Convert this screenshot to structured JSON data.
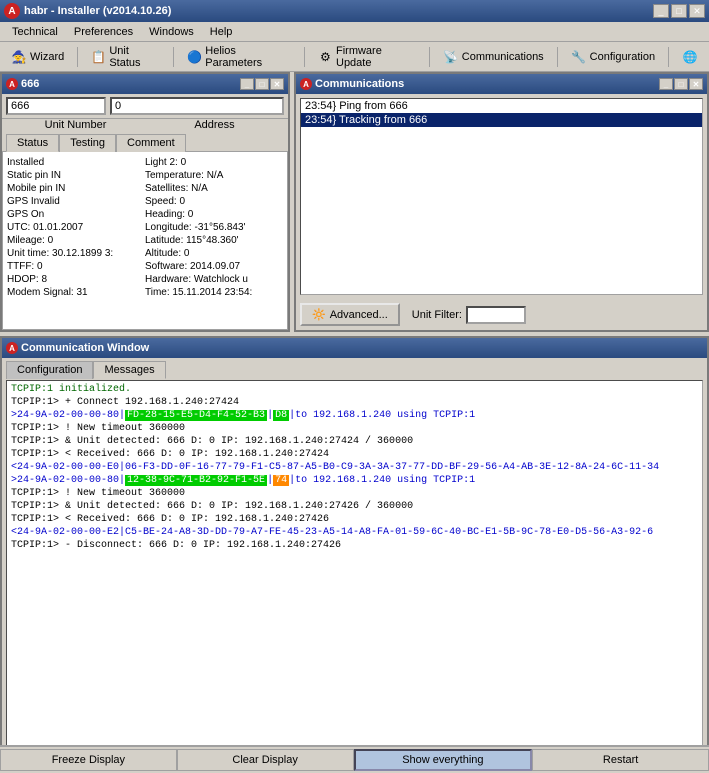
{
  "titlebar": {
    "icon": "A",
    "title": "habr - Installer (v2014.10.26)",
    "btns": [
      "_",
      "□",
      "✕"
    ]
  },
  "menubar": {
    "items": [
      "Technical",
      "Preferences",
      "Windows",
      "Help"
    ]
  },
  "toolbar": {
    "buttons": [
      {
        "icon": "🧙",
        "label": "Wizard"
      },
      {
        "icon": "📋",
        "label": "Unit Status"
      },
      {
        "icon": "🔵",
        "label": "Helios Parameters"
      },
      {
        "icon": "⚙",
        "label": "Firmware Update"
      },
      {
        "icon": "📡",
        "label": "Communications"
      },
      {
        "icon": "🔧",
        "label": "Configuration"
      },
      {
        "icon": "🌐",
        "label": ""
      }
    ]
  },
  "unit_window": {
    "title": "666",
    "number_value": "666",
    "address_value": "0",
    "col1_label": "Unit Number",
    "col2_label": "Address",
    "tabs": [
      "Status",
      "Testing",
      "Comment"
    ],
    "active_tab": "Status",
    "status": {
      "col1": [
        "Installed",
        "Static pin IN",
        "Mobile pin IN",
        "GPS Invalid",
        "GPS On",
        "UTC: 01.01.2007",
        "Mileage: 0",
        "Unit time: 30.12.1899 3:",
        "TTFF: 0",
        "HDOP: 8",
        "Modem Signal: 31"
      ],
      "col2": [
        "Light 2: 0",
        "Temperature: N/A",
        "Satellites: N/A",
        "Speed: 0",
        "Heading: 0",
        "Longitude: -31°56.843'",
        "Latitude: 115°48.360'",
        "Altitude: 0",
        "Software: 2014.09.07",
        "Hardware: Watchlock u",
        "Time: 15.11.2014 23:54:"
      ]
    }
  },
  "comm_window": {
    "title": "Communications",
    "items": [
      {
        "text": "23:54} Ping from 666",
        "selected": false
      },
      {
        "text": "23:54} Tracking from 666",
        "selected": true
      }
    ],
    "advanced_btn": "Advanced...",
    "unit_filter_label": "Unit Filter:"
  },
  "comm_bottom": {
    "title": "Communication Window",
    "tabs": [
      "Configuration",
      "Messages"
    ],
    "active_tab": "Messages",
    "log": [
      {
        "text": "TCPIP:1 initialized.",
        "style": "green"
      },
      {
        "text": "TCPIP:1> + Connect  192.168.1.240:27424",
        "style": "default"
      },
      {
        "text": ">24-9A-02-00-00-80|FD-28-15-E5-D4-F4-52-B3|D8|to 192.168.1.240 using TCPIP:1",
        "style": "blue",
        "highlight1": "FD-28-15-E5-D4-F4-52-B3",
        "hl1_color": "green",
        "highlight2": "D8",
        "hl2_color": "green"
      },
      {
        "text": "TCPIP:1> ! New timeout 360000",
        "style": "default"
      },
      {
        "text": "TCPIP:1> & Unit detected:   666 D: 0 IP: 192.168.1.240:27424 / 360000",
        "style": "default"
      },
      {
        "text": "TCPIP:1> < Received:   666 D: 0 IP: 192.168.1.240:27424",
        "style": "default"
      },
      {
        "text": "<24-9A-02-00-00-E0|06-F3-DD-0F-16-77-79-F1-C5-87-A5-B0-C9-3A-3A-37-77-DD-BF-29-56-A4-AB-3E-12-8A-24-6C-11-34",
        "style": "blue"
      },
      {
        "text": ">24-9A-02-00-00-80|12-38-9C-71-B2-92-F1-5E|74|to 192.168.1.240 using TCPIP:1",
        "style": "blue",
        "highlight1": "12-38-9C-71-B2-92-F1-5E",
        "hl1_color": "green",
        "highlight2": "74",
        "hl2_color": "orange"
      },
      {
        "text": "TCPIP:1> ! New timeout 360000",
        "style": "default"
      },
      {
        "text": "TCPIP:1> & Unit detected:   666 D: 0 IP: 192.168.1.240:27426 / 360000",
        "style": "default"
      },
      {
        "text": "TCPIP:1> < Received:   666 D: 0 IP: 192.168.1.240:27426",
        "style": "default"
      },
      {
        "text": "<24-9A-02-00-00-E2|C5-BE-24-A8-3D-DD-79-A7-FE-45-23-A5-14-A8-FA-01-59-6C-40-BC-E1-5B-9C-78-E0-D5-56-A3-92-6",
        "style": "blue"
      },
      {
        "text": "TCPIP:1> - Disconnect:   666 D: 0 IP: 192.168.1.240:27426",
        "style": "default"
      }
    ]
  },
  "bottom_bar": {
    "buttons": [
      "Freeze Display",
      "Clear Display",
      "Show everything",
      "Restart"
    ]
  }
}
